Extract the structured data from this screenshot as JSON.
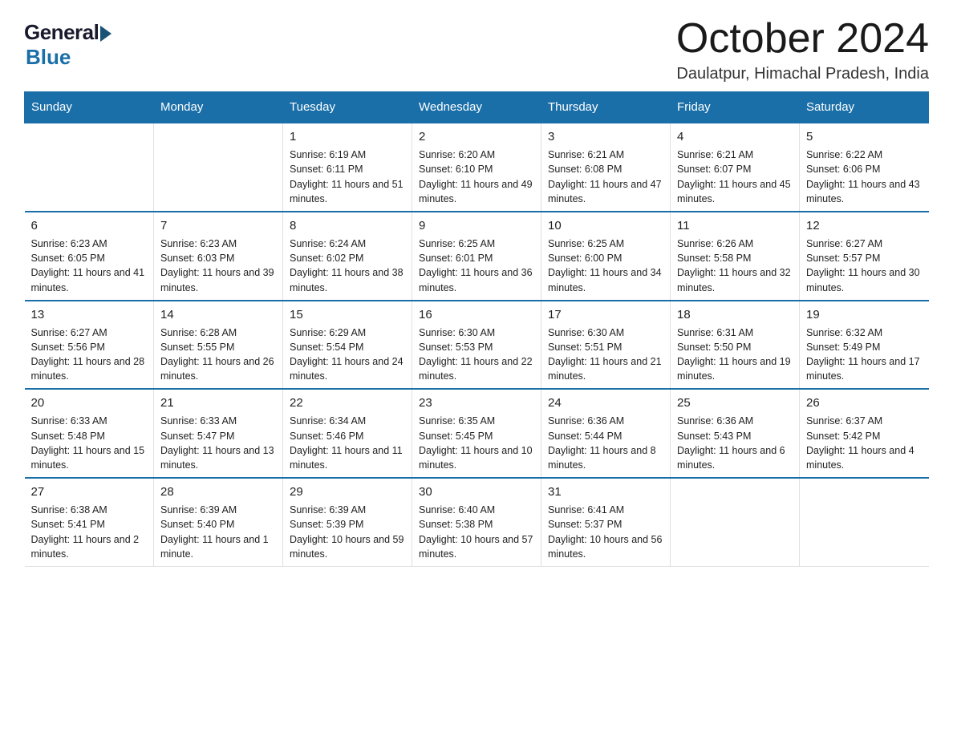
{
  "header": {
    "logo_general": "General",
    "logo_blue": "Blue",
    "month": "October 2024",
    "location": "Daulatpur, Himachal Pradesh, India"
  },
  "weekdays": [
    "Sunday",
    "Monday",
    "Tuesday",
    "Wednesday",
    "Thursday",
    "Friday",
    "Saturday"
  ],
  "weeks": [
    [
      {
        "day": "",
        "sunrise": "",
        "sunset": "",
        "daylight": ""
      },
      {
        "day": "",
        "sunrise": "",
        "sunset": "",
        "daylight": ""
      },
      {
        "day": "1",
        "sunrise": "Sunrise: 6:19 AM",
        "sunset": "Sunset: 6:11 PM",
        "daylight": "Daylight: 11 hours and 51 minutes."
      },
      {
        "day": "2",
        "sunrise": "Sunrise: 6:20 AM",
        "sunset": "Sunset: 6:10 PM",
        "daylight": "Daylight: 11 hours and 49 minutes."
      },
      {
        "day": "3",
        "sunrise": "Sunrise: 6:21 AM",
        "sunset": "Sunset: 6:08 PM",
        "daylight": "Daylight: 11 hours and 47 minutes."
      },
      {
        "day": "4",
        "sunrise": "Sunrise: 6:21 AM",
        "sunset": "Sunset: 6:07 PM",
        "daylight": "Daylight: 11 hours and 45 minutes."
      },
      {
        "day": "5",
        "sunrise": "Sunrise: 6:22 AM",
        "sunset": "Sunset: 6:06 PM",
        "daylight": "Daylight: 11 hours and 43 minutes."
      }
    ],
    [
      {
        "day": "6",
        "sunrise": "Sunrise: 6:23 AM",
        "sunset": "Sunset: 6:05 PM",
        "daylight": "Daylight: 11 hours and 41 minutes."
      },
      {
        "day": "7",
        "sunrise": "Sunrise: 6:23 AM",
        "sunset": "Sunset: 6:03 PM",
        "daylight": "Daylight: 11 hours and 39 minutes."
      },
      {
        "day": "8",
        "sunrise": "Sunrise: 6:24 AM",
        "sunset": "Sunset: 6:02 PM",
        "daylight": "Daylight: 11 hours and 38 minutes."
      },
      {
        "day": "9",
        "sunrise": "Sunrise: 6:25 AM",
        "sunset": "Sunset: 6:01 PM",
        "daylight": "Daylight: 11 hours and 36 minutes."
      },
      {
        "day": "10",
        "sunrise": "Sunrise: 6:25 AM",
        "sunset": "Sunset: 6:00 PM",
        "daylight": "Daylight: 11 hours and 34 minutes."
      },
      {
        "day": "11",
        "sunrise": "Sunrise: 6:26 AM",
        "sunset": "Sunset: 5:58 PM",
        "daylight": "Daylight: 11 hours and 32 minutes."
      },
      {
        "day": "12",
        "sunrise": "Sunrise: 6:27 AM",
        "sunset": "Sunset: 5:57 PM",
        "daylight": "Daylight: 11 hours and 30 minutes."
      }
    ],
    [
      {
        "day": "13",
        "sunrise": "Sunrise: 6:27 AM",
        "sunset": "Sunset: 5:56 PM",
        "daylight": "Daylight: 11 hours and 28 minutes."
      },
      {
        "day": "14",
        "sunrise": "Sunrise: 6:28 AM",
        "sunset": "Sunset: 5:55 PM",
        "daylight": "Daylight: 11 hours and 26 minutes."
      },
      {
        "day": "15",
        "sunrise": "Sunrise: 6:29 AM",
        "sunset": "Sunset: 5:54 PM",
        "daylight": "Daylight: 11 hours and 24 minutes."
      },
      {
        "day": "16",
        "sunrise": "Sunrise: 6:30 AM",
        "sunset": "Sunset: 5:53 PM",
        "daylight": "Daylight: 11 hours and 22 minutes."
      },
      {
        "day": "17",
        "sunrise": "Sunrise: 6:30 AM",
        "sunset": "Sunset: 5:51 PM",
        "daylight": "Daylight: 11 hours and 21 minutes."
      },
      {
        "day": "18",
        "sunrise": "Sunrise: 6:31 AM",
        "sunset": "Sunset: 5:50 PM",
        "daylight": "Daylight: 11 hours and 19 minutes."
      },
      {
        "day": "19",
        "sunrise": "Sunrise: 6:32 AM",
        "sunset": "Sunset: 5:49 PM",
        "daylight": "Daylight: 11 hours and 17 minutes."
      }
    ],
    [
      {
        "day": "20",
        "sunrise": "Sunrise: 6:33 AM",
        "sunset": "Sunset: 5:48 PM",
        "daylight": "Daylight: 11 hours and 15 minutes."
      },
      {
        "day": "21",
        "sunrise": "Sunrise: 6:33 AM",
        "sunset": "Sunset: 5:47 PM",
        "daylight": "Daylight: 11 hours and 13 minutes."
      },
      {
        "day": "22",
        "sunrise": "Sunrise: 6:34 AM",
        "sunset": "Sunset: 5:46 PM",
        "daylight": "Daylight: 11 hours and 11 minutes."
      },
      {
        "day": "23",
        "sunrise": "Sunrise: 6:35 AM",
        "sunset": "Sunset: 5:45 PM",
        "daylight": "Daylight: 11 hours and 10 minutes."
      },
      {
        "day": "24",
        "sunrise": "Sunrise: 6:36 AM",
        "sunset": "Sunset: 5:44 PM",
        "daylight": "Daylight: 11 hours and 8 minutes."
      },
      {
        "day": "25",
        "sunrise": "Sunrise: 6:36 AM",
        "sunset": "Sunset: 5:43 PM",
        "daylight": "Daylight: 11 hours and 6 minutes."
      },
      {
        "day": "26",
        "sunrise": "Sunrise: 6:37 AM",
        "sunset": "Sunset: 5:42 PM",
        "daylight": "Daylight: 11 hours and 4 minutes."
      }
    ],
    [
      {
        "day": "27",
        "sunrise": "Sunrise: 6:38 AM",
        "sunset": "Sunset: 5:41 PM",
        "daylight": "Daylight: 11 hours and 2 minutes."
      },
      {
        "day": "28",
        "sunrise": "Sunrise: 6:39 AM",
        "sunset": "Sunset: 5:40 PM",
        "daylight": "Daylight: 11 hours and 1 minute."
      },
      {
        "day": "29",
        "sunrise": "Sunrise: 6:39 AM",
        "sunset": "Sunset: 5:39 PM",
        "daylight": "Daylight: 10 hours and 59 minutes."
      },
      {
        "day": "30",
        "sunrise": "Sunrise: 6:40 AM",
        "sunset": "Sunset: 5:38 PM",
        "daylight": "Daylight: 10 hours and 57 minutes."
      },
      {
        "day": "31",
        "sunrise": "Sunrise: 6:41 AM",
        "sunset": "Sunset: 5:37 PM",
        "daylight": "Daylight: 10 hours and 56 minutes."
      },
      {
        "day": "",
        "sunrise": "",
        "sunset": "",
        "daylight": ""
      },
      {
        "day": "",
        "sunrise": "",
        "sunset": "",
        "daylight": ""
      }
    ]
  ]
}
